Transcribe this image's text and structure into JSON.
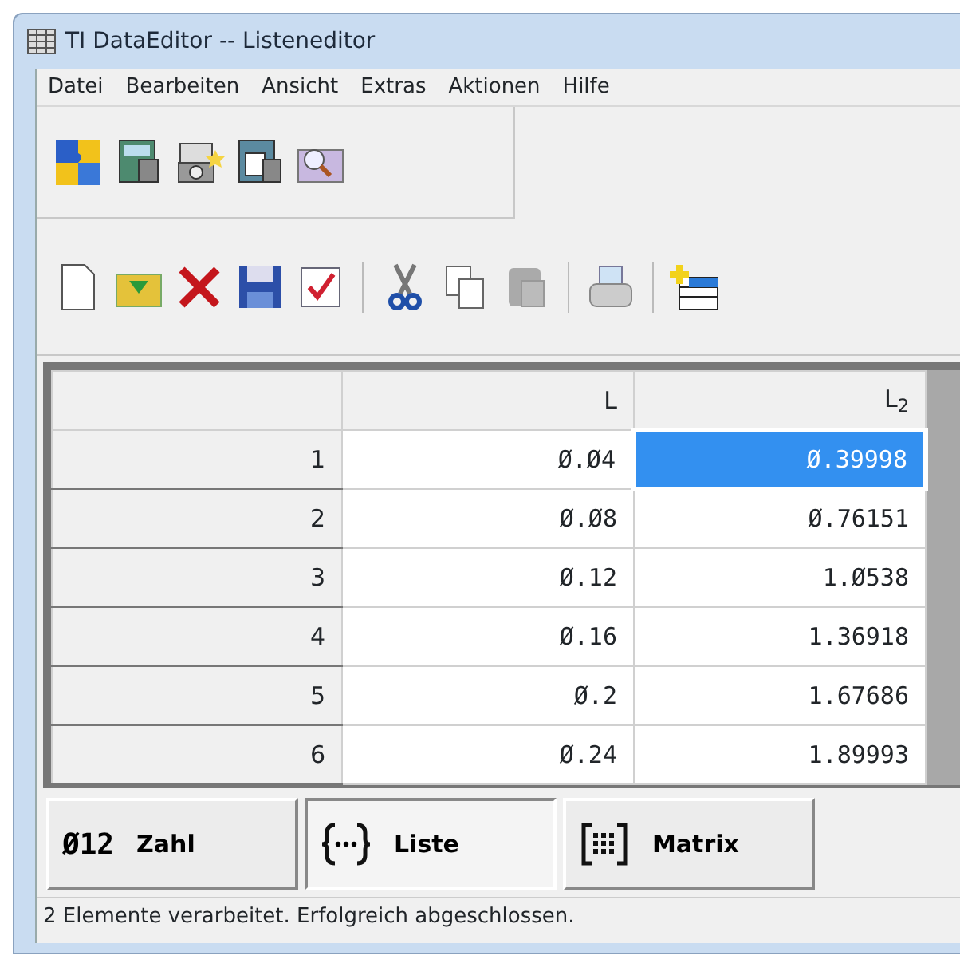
{
  "window": {
    "title": "TI DataEditor -- Listeneditor"
  },
  "menu": [
    "Datei",
    "Bearbeiten",
    "Ansicht",
    "Extras",
    "Aktionen",
    "Hilfe"
  ],
  "table": {
    "columns": [
      "L",
      "L$_{2}$"
    ],
    "rows": [
      {
        "index": "1",
        "cells": [
          {
            "value": "Ø.Ø4",
            "selected": false
          },
          {
            "value": "Ø.39998",
            "selected": true
          }
        ]
      },
      {
        "index": "2",
        "cells": [
          {
            "value": "Ø.Ø8",
            "selected": false
          },
          {
            "value": "Ø.76151",
            "selected": false
          }
        ]
      },
      {
        "index": "3",
        "cells": [
          {
            "value": "Ø.12",
            "selected": false
          },
          {
            "value": "1.Ø538",
            "selected": false
          }
        ]
      },
      {
        "index": "4",
        "cells": [
          {
            "value": "Ø.16",
            "selected": false
          },
          {
            "value": "1.36918",
            "selected": false
          }
        ]
      },
      {
        "index": "5",
        "cells": [
          {
            "value": "Ø.2",
            "selected": false
          },
          {
            "value": "1.67686",
            "selected": false
          }
        ]
      },
      {
        "index": "6",
        "cells": [
          {
            "value": "Ø.24",
            "selected": false
          },
          {
            "value": "1.89993",
            "selected": false
          }
        ]
      }
    ]
  },
  "type_buttons": [
    {
      "kind": "number",
      "symbol": "Ø12",
      "label": "Zahl",
      "selected": false
    },
    {
      "kind": "list",
      "label": "Liste",
      "selected": true
    },
    {
      "kind": "matrix",
      "label": "Matrix",
      "selected": false
    }
  ],
  "status_bar": "2 Elemente verarbeitet. Erfolgreich abgeschlossen."
}
